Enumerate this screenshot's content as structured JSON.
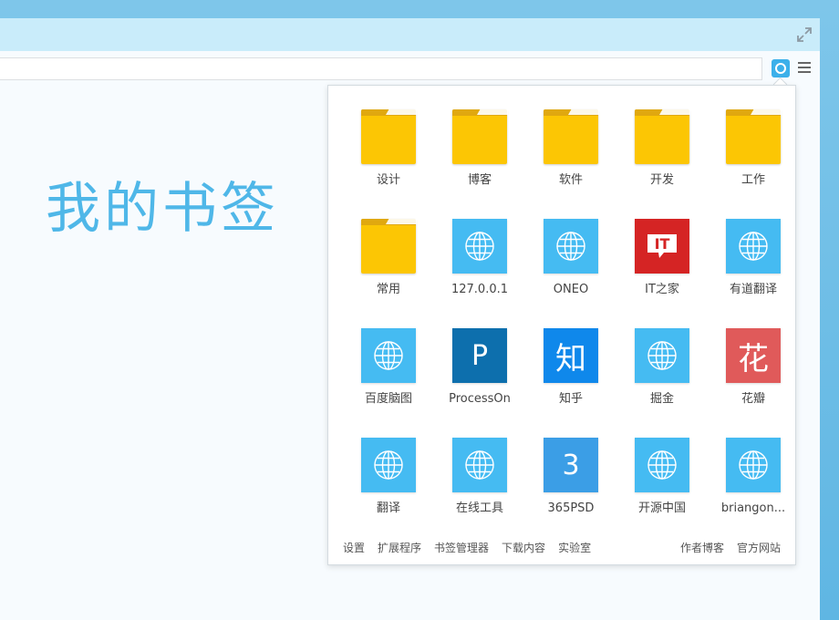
{
  "page_title": "我的书签",
  "bookmarks": [
    {
      "label": "设计",
      "type": "folder"
    },
    {
      "label": "博客",
      "type": "folder"
    },
    {
      "label": "软件",
      "type": "folder"
    },
    {
      "label": "开发",
      "type": "folder"
    },
    {
      "label": "工作",
      "type": "folder"
    },
    {
      "label": "常用",
      "type": "folder"
    },
    {
      "label": "127.0.0.1",
      "type": "globe"
    },
    {
      "label": "ONEO",
      "type": "globe"
    },
    {
      "label": "IT之家",
      "type": "it-logo",
      "glyph": "IT"
    },
    {
      "label": "有道翻译",
      "type": "globe"
    },
    {
      "label": "百度脑图",
      "type": "globe"
    },
    {
      "label": "ProcessOn",
      "type": "letter",
      "glyph": "P"
    },
    {
      "label": "知乎",
      "type": "letter",
      "glyph": "知"
    },
    {
      "label": "掘金",
      "type": "globe"
    },
    {
      "label": "花瓣",
      "type": "letter",
      "glyph": "花"
    },
    {
      "label": "翻译",
      "type": "globe"
    },
    {
      "label": "在线工具",
      "type": "globe"
    },
    {
      "label": "365PSD",
      "type": "letter",
      "glyph": "3"
    },
    {
      "label": "开源中国",
      "type": "globe"
    },
    {
      "label": "briangon...",
      "type": "globe"
    }
  ],
  "footer": {
    "left": [
      "设置",
      "扩展程序",
      "书签管理器",
      "下载内容",
      "实验室"
    ],
    "right": [
      "作者博客",
      "官方网站"
    ]
  },
  "colors": {
    "accent": "#4fb7e8",
    "folder": "#fcc604",
    "globe_tile": "#45bbf2",
    "processon": "#0d6fad",
    "zhihu": "#0f88eb",
    "huaban": "#e05a5a",
    "psd365": "#3b9ee6",
    "ithome": "#d52424"
  }
}
